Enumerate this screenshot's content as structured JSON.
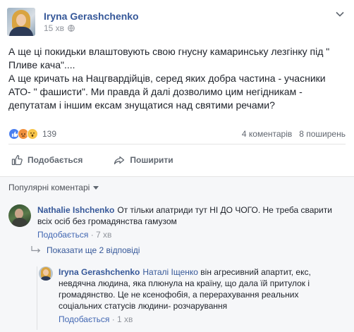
{
  "post": {
    "author": "Iryna Gerashchenko",
    "time": "15 хв",
    "text_lines": [
      "А ще ці покидьки влаштовують свою гнусну камаринську лезгінку під \" Пливе кача\"....",
      "А ще кричать на Нацгвардійців, серед яких добра частина - учасники АТО- \" фашисти\". Ми правда й далі дозволимо цим негідникам - депутатам і іншим ексам знущатися над святими речами?"
    ],
    "reaction_count": "139",
    "comments_count": "4 коментарів",
    "shares_count": "8 поширень"
  },
  "actions": {
    "like_label": "Подобається",
    "share_label": "Поширити"
  },
  "comments_section": {
    "sort_label": "Популярні коментарі",
    "comment1": {
      "author": "Nathalie Ishchenko",
      "text": "От тільки апатриди тут НІ ДО ЧОГО. Не треба сварити всіх осіб без громадянства гамузом",
      "like_label": "Подобається",
      "time": "7 хв"
    },
    "show_replies_label": "Показати ще 2 відповіді",
    "reply1": {
      "author": "Iryna Gerashchenko",
      "mention": "Наталі Іщенко",
      "text": "він агресивний апартит, екс, невдячна людина, яка плюнула на країну, що дала їй притулок і громадянство. Це не ксенофобія, а перерахування реальних соціальних статусів людини- розчарування",
      "like_label": "Подобається",
      "time": "1 хв"
    }
  },
  "colors": {
    "link": "#365899",
    "meta": "#90949c",
    "comments_bg": "#f6f7f9"
  }
}
